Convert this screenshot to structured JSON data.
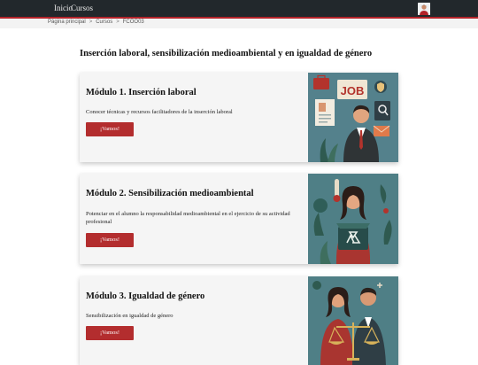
{
  "nav": {
    "home": "Inicio",
    "courses": "Cursos"
  },
  "breadcrumb": {
    "home": "Página principal",
    "courses": "Cursos",
    "current": "FCOO03",
    "separator": ">"
  },
  "page": {
    "title": "Inserción laboral, sensibilización medioambiental y en igualdad de género"
  },
  "modules": [
    {
      "title": "Módulo 1. Inserción laboral",
      "description": "Conocer técnicas y recursos facilitadores de la inserción laboral",
      "button": "¡Vamos!",
      "image_text": "JOB"
    },
    {
      "title": "Módulo 2. Sensibilización medioambiental",
      "description": "Potenciar en el alumno la responsabilidad medioambiental en el ejercicio de su actividad profesional",
      "button": "¡Vamos!"
    },
    {
      "title": "Módulo 3. Igualdad de género",
      "description": "Sensibilización en igualdad de género",
      "button": "¡Vamos!"
    }
  ],
  "colors": {
    "topbar": "#22282c",
    "accent": "#b3232a",
    "button": "#b32d2e",
    "card": "#f5f5f5"
  }
}
